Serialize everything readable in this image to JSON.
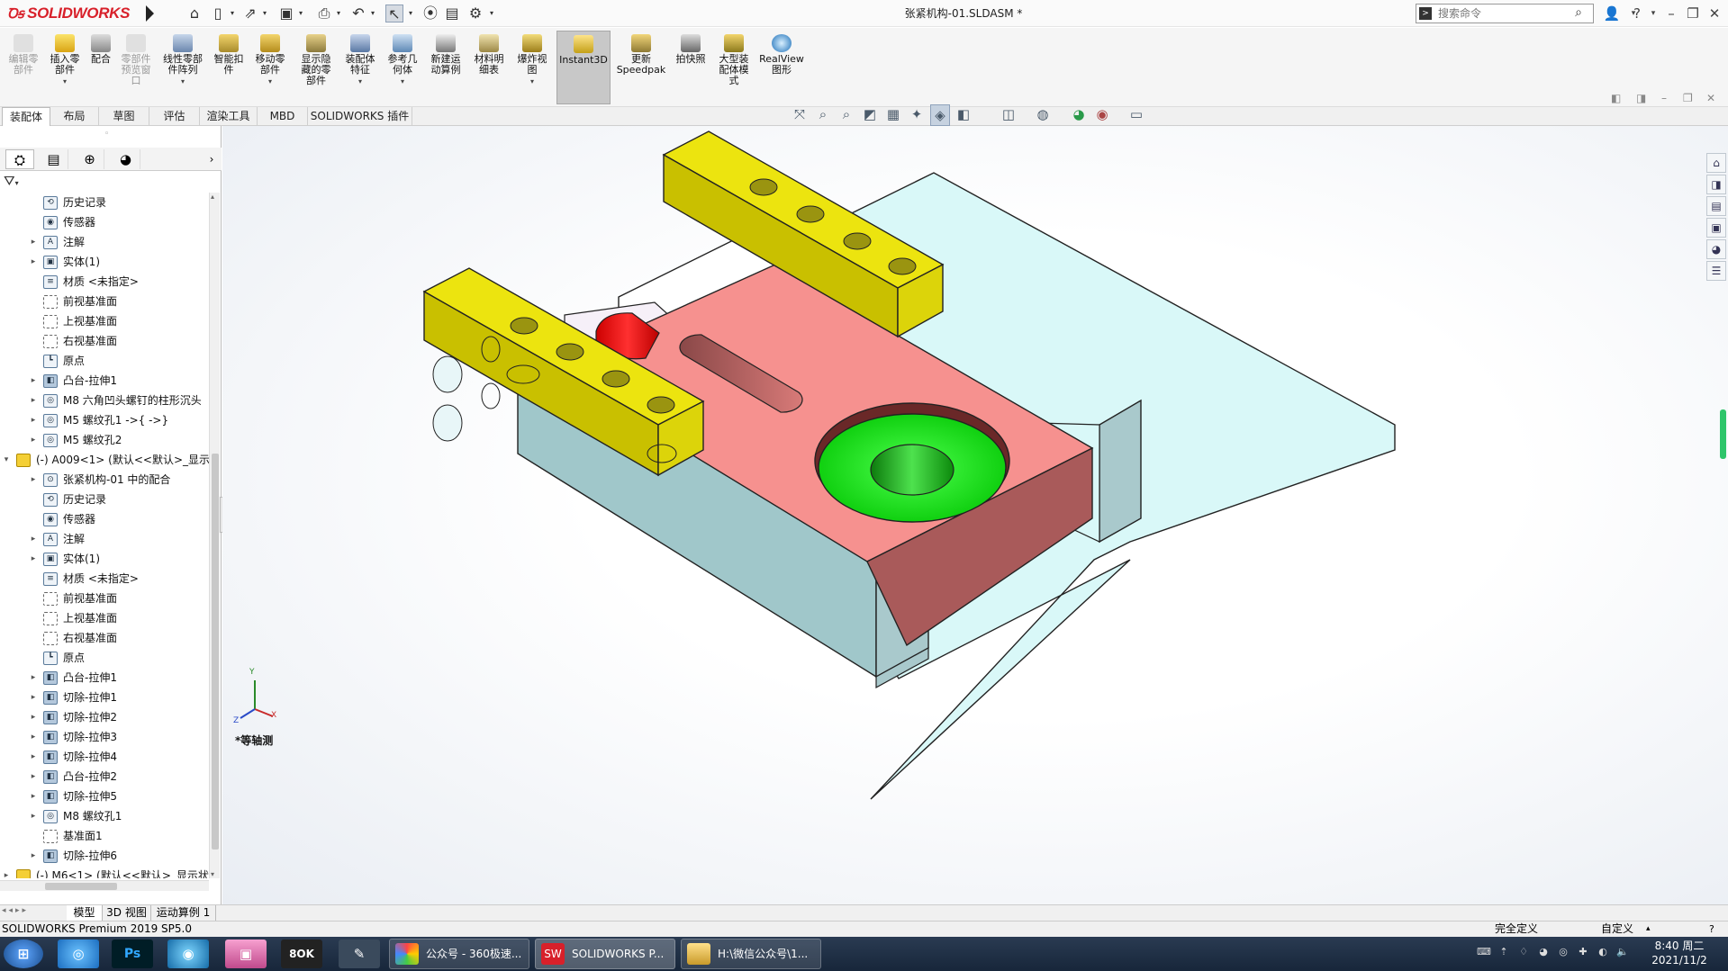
{
  "app": {
    "logo": "SOLIDWORKS",
    "document_title": "张紧机构-01.SLDASM *",
    "search_placeholder": "搜索命令"
  },
  "quick_access": [
    "home-icon",
    "new-icon",
    "open-icon",
    "save-icon",
    "print-icon",
    "undo-icon",
    "select-icon",
    "rebuild-icon",
    "file-properties-icon",
    "options-icon"
  ],
  "ribbon": {
    "buttons": [
      {
        "label": "编辑零\n部件",
        "disabled": true
      },
      {
        "label": "插入零\n部件",
        "disabled": false
      },
      {
        "label": "配合",
        "disabled": false
      },
      {
        "label": "零部件\n预览窗\n口",
        "disabled": true
      },
      {
        "label": "线性零部\n件阵列",
        "disabled": false
      },
      {
        "label": "智能扣\n件",
        "disabled": false
      },
      {
        "label": "移动零\n部件",
        "disabled": false
      },
      {
        "label": "显示隐\n藏的零\n部件",
        "disabled": false
      },
      {
        "label": "装配体\n特征",
        "disabled": false
      },
      {
        "label": "参考几\n何体",
        "disabled": false
      },
      {
        "label": "新建运\n动算例",
        "disabled": false
      },
      {
        "label": "材料明\n细表",
        "disabled": false
      },
      {
        "label": "爆炸视\n图",
        "disabled": false
      },
      {
        "label": "Instant3D",
        "disabled": false,
        "active": true
      },
      {
        "label": "更新\nSpeedpak",
        "disabled": false
      },
      {
        "label": "拍快照",
        "disabled": false
      },
      {
        "label": "大型装\n配体模\n式",
        "disabled": false
      },
      {
        "label": "RealView\n图形",
        "disabled": false
      }
    ]
  },
  "command_tabs": [
    "装配体",
    "布局",
    "草图",
    "评估",
    "渲染工具",
    "MBD",
    "SOLIDWORKS 插件"
  ],
  "tree": [
    {
      "label": "历史记录",
      "level": 2,
      "arrow": "",
      "icon": "history"
    },
    {
      "label": "传感器",
      "level": 2,
      "arrow": "",
      "icon": "sensor"
    },
    {
      "label": "注解",
      "level": 2,
      "arrow": "▸",
      "icon": "annotation"
    },
    {
      "label": "实体(1)",
      "level": 2,
      "arrow": "▸",
      "icon": "solid-body"
    },
    {
      "label": "材质 <未指定>",
      "level": 2,
      "arrow": "",
      "icon": "material"
    },
    {
      "label": "前视基准面",
      "level": 2,
      "arrow": "",
      "icon": "plane"
    },
    {
      "label": "上视基准面",
      "level": 2,
      "arrow": "",
      "icon": "plane"
    },
    {
      "label": "右视基准面",
      "level": 2,
      "arrow": "",
      "icon": "plane"
    },
    {
      "label": "原点",
      "level": 2,
      "arrow": "",
      "icon": "origin"
    },
    {
      "label": "凸台-拉伸1",
      "level": 2,
      "arrow": "▸",
      "icon": "feature"
    },
    {
      "label": "M8 六角凹头螺钉的柱形沉头",
      "level": 2,
      "arrow": "▸",
      "icon": "hole"
    },
    {
      "label": "M5 螺纹孔1 ->{ ->}",
      "level": 2,
      "arrow": "▸",
      "icon": "hole"
    },
    {
      "label": "M5 螺纹孔2",
      "level": 2,
      "arrow": "▸",
      "icon": "hole"
    },
    {
      "label": "(-) A009<1> (默认<<默认>_显示",
      "level": 1,
      "arrow": "▾",
      "icon": "part"
    },
    {
      "label": "张紧机构-01 中的配合",
      "level": 2,
      "arrow": "▸",
      "icon": "mates"
    },
    {
      "label": "历史记录",
      "level": 2,
      "arrow": "",
      "icon": "history"
    },
    {
      "label": "传感器",
      "level": 2,
      "arrow": "",
      "icon": "sensor"
    },
    {
      "label": "注解",
      "level": 2,
      "arrow": "▸",
      "icon": "annotation"
    },
    {
      "label": "实体(1)",
      "level": 2,
      "arrow": "▸",
      "icon": "solid-body"
    },
    {
      "label": "材质 <未指定>",
      "level": 2,
      "arrow": "",
      "icon": "material"
    },
    {
      "label": "前视基准面",
      "level": 2,
      "arrow": "",
      "icon": "plane"
    },
    {
      "label": "上视基准面",
      "level": 2,
      "arrow": "",
      "icon": "plane"
    },
    {
      "label": "右视基准面",
      "level": 2,
      "arrow": "",
      "icon": "plane"
    },
    {
      "label": "原点",
      "level": 2,
      "arrow": "",
      "icon": "origin"
    },
    {
      "label": "凸台-拉伸1",
      "level": 2,
      "arrow": "▸",
      "icon": "feature"
    },
    {
      "label": "切除-拉伸1",
      "level": 2,
      "arrow": "▸",
      "icon": "feature"
    },
    {
      "label": "切除-拉伸2",
      "level": 2,
      "arrow": "▸",
      "icon": "feature"
    },
    {
      "label": "切除-拉伸3",
      "level": 2,
      "arrow": "▸",
      "icon": "feature"
    },
    {
      "label": "切除-拉伸4",
      "level": 2,
      "arrow": "▸",
      "icon": "feature"
    },
    {
      "label": "凸台-拉伸2",
      "level": 2,
      "arrow": "▸",
      "icon": "feature"
    },
    {
      "label": "切除-拉伸5",
      "level": 2,
      "arrow": "▸",
      "icon": "feature"
    },
    {
      "label": "M8 螺纹孔1",
      "level": 2,
      "arrow": "▸",
      "icon": "hole"
    },
    {
      "label": "基准面1",
      "level": 2,
      "arrow": "",
      "icon": "plane"
    },
    {
      "label": "切除-拉伸6",
      "level": 2,
      "arrow": "▸",
      "icon": "feature"
    },
    {
      "label": "(-) M6<1> (默认<<默认>_显示状",
      "level": 1,
      "arrow": "▸",
      "icon": "part"
    }
  ],
  "viewport": {
    "view_label": "*等轴测",
    "triad_labels": [
      "Y",
      "X",
      "Z"
    ],
    "colors": {
      "base_plate": "#9fc7c9",
      "base_top": "#d7f6f6",
      "slider_top": "#f6918f",
      "slider_side": "#a85a5a",
      "yellow_block": "#e8e210",
      "yellow_side": "#c9c000",
      "green_disc": "#19e619",
      "red_pin": "#ff1010",
      "end_block": "#a9c9cc"
    }
  },
  "bottom_tabs": [
    "模型",
    "3D 视图",
    "运动算例 1"
  ],
  "status": {
    "product": "SOLIDWORKS Premium 2019 SP5.0",
    "state": "完全定义",
    "units": "自定义"
  },
  "taskbar": {
    "windows": [
      {
        "label": "公众号 - 360极速..."
      },
      {
        "label": "SOLIDWORKS P..."
      },
      {
        "label": "H:\\微信公众号\\1..."
      }
    ],
    "time": "8:40 周二",
    "date": "2021/11/2"
  }
}
